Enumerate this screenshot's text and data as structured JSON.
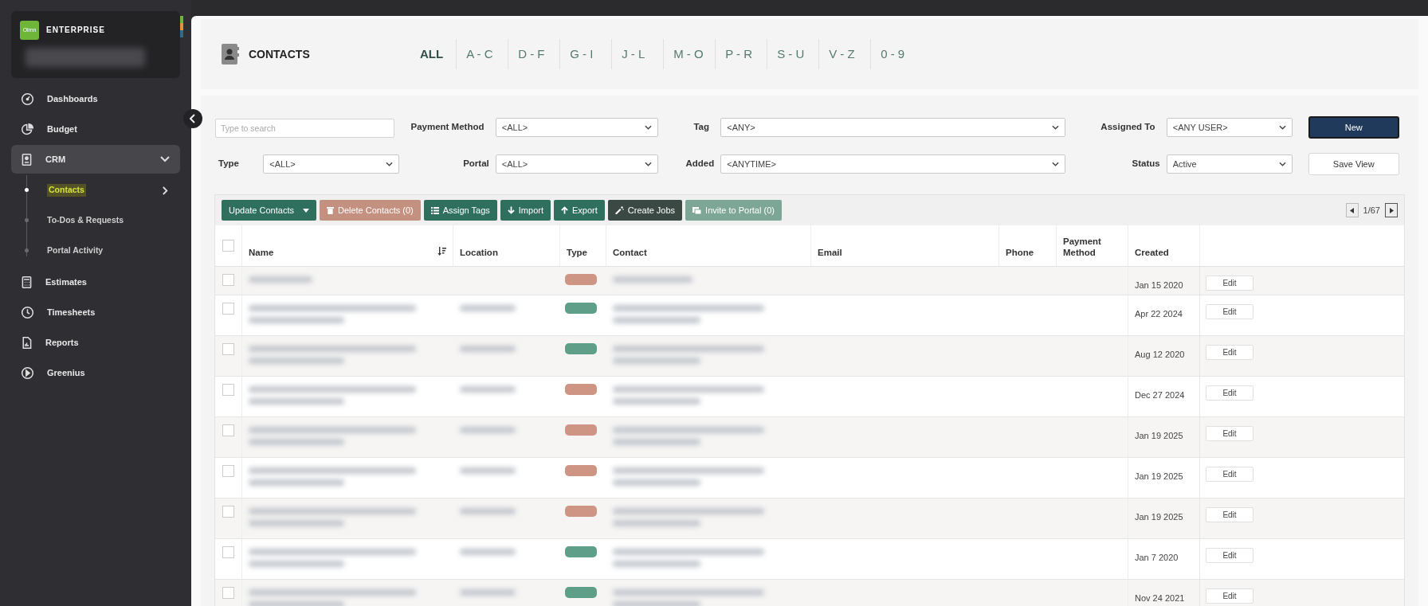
{
  "sidebar": {
    "brand": {
      "logo": "Olmn",
      "title": "ENTERPRISE"
    },
    "items": [
      {
        "label": "Dashboards",
        "selected": false
      },
      {
        "label": "Budget",
        "selected": false
      },
      {
        "label": "CRM",
        "expanded": true,
        "children": [
          {
            "label": "Contacts",
            "selected": true
          },
          {
            "label": "To-Dos & Requests",
            "selected": false
          },
          {
            "label": "Portal Activity",
            "selected": false
          }
        ]
      },
      {
        "label": "Estimates",
        "selected": false
      },
      {
        "label": "Timesheets",
        "selected": false
      },
      {
        "label": "Reports",
        "selected": false
      },
      {
        "label": "Greenius",
        "selected": false
      }
    ]
  },
  "header": {
    "title": "CONTACTS",
    "tabs": [
      {
        "label": "ALL",
        "selected": true
      },
      {
        "label": "A - C",
        "selected": false
      },
      {
        "label": "D - F",
        "selected": false
      },
      {
        "label": "G - I",
        "selected": false
      },
      {
        "label": "J - L",
        "selected": false
      },
      {
        "label": "M - O",
        "selected": false
      },
      {
        "label": "P - R",
        "selected": false
      },
      {
        "label": "S - U",
        "selected": false
      },
      {
        "label": "V - Z",
        "selected": false
      },
      {
        "label": "0 - 9",
        "selected": false
      }
    ]
  },
  "filters": {
    "search": {
      "placeholder": "Type to search"
    },
    "type": {
      "label": "Type",
      "value": "<ALL>"
    },
    "payment_method": {
      "label": "Payment Method",
      "value": "<ALL>"
    },
    "portal": {
      "label": "Portal",
      "value": "<ALL>"
    },
    "tag": {
      "label": "Tag",
      "value": "<ANY>"
    },
    "added": {
      "label": "Added",
      "value": "<ANYTIME>"
    },
    "assigned_to": {
      "label": "Assigned To",
      "value": "<ANY USER>"
    },
    "status": {
      "label": "Status",
      "value": "Active"
    },
    "new_button": "New",
    "save_view_button": "Save View"
  },
  "toolbar": {
    "buttons": [
      {
        "label": "Update Contacts",
        "color": "#2f6f5d",
        "kind": "dropdown"
      },
      {
        "label": "Delete Contacts (0)",
        "color": "#c4907f",
        "kind": "trash"
      },
      {
        "label": "Assign Tags",
        "color": "#2f6f5d",
        "kind": "list"
      },
      {
        "label": "Import",
        "color": "#2f6f5d",
        "kind": "down"
      },
      {
        "label": "Export",
        "color": "#2f6f5d",
        "kind": "up"
      },
      {
        "label": "Create Jobs",
        "color": "#3a4944",
        "kind": "wand"
      },
      {
        "label": "Invite to Portal (0)",
        "color": "#7ea697",
        "kind": "card"
      }
    ],
    "pager": "1/67"
  },
  "table": {
    "header_checked": false,
    "columns": [
      "Name",
      "Location",
      "Type",
      "Contact",
      "Email",
      "Phone",
      "Payment Method",
      "Created"
    ],
    "rows": [
      {
        "checked": false,
        "kind": "short",
        "color": "#cf9584",
        "created": "Jan 15 2020",
        "edit": "Edit"
      },
      {
        "checked": false,
        "kind": "tall",
        "color": "#5f9f8a",
        "created": "Apr 22 2024",
        "edit": "Edit"
      },
      {
        "checked": false,
        "kind": "tall",
        "color": "#5f9f8a",
        "created": "Aug 12 2020",
        "edit": "Edit"
      },
      {
        "checked": false,
        "kind": "tall",
        "color": "#cf9584",
        "created": "Dec 27 2024",
        "edit": "Edit"
      },
      {
        "checked": false,
        "kind": "tall",
        "color": "#cf9584",
        "created": "Jan 19 2025",
        "edit": "Edit"
      },
      {
        "checked": false,
        "kind": "tall",
        "color": "#cf9584",
        "created": "Jan 19 2025",
        "edit": "Edit"
      },
      {
        "checked": false,
        "kind": "tall",
        "color": "#cf9584",
        "created": "Jan 19 2025",
        "edit": "Edit"
      },
      {
        "checked": false,
        "kind": "tall",
        "color": "#5f9f8a",
        "created": "Jan 7 2020",
        "edit": "Edit"
      },
      {
        "checked": false,
        "kind": "tall",
        "color": "#5f9f8a",
        "created": "Nov 24 2021",
        "edit": "Edit"
      }
    ]
  }
}
